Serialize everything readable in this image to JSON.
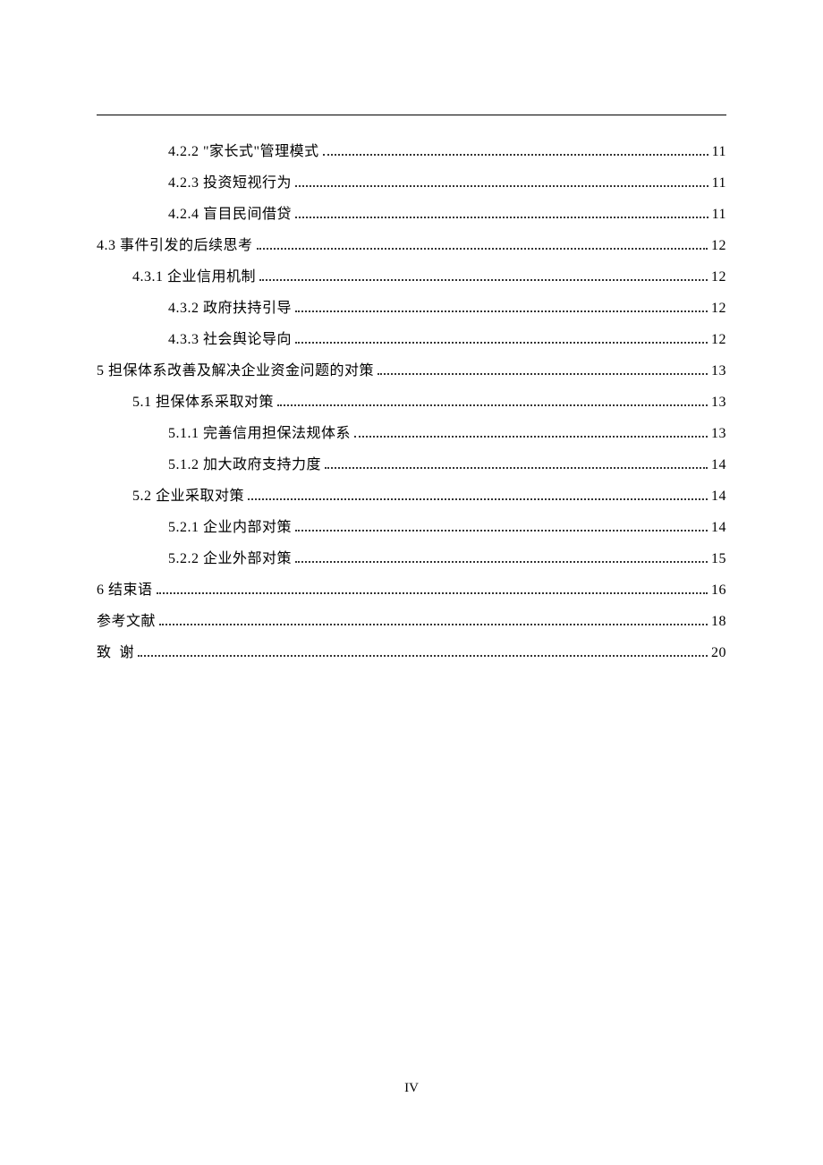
{
  "page_number_label": "IV",
  "toc": [
    {
      "indent": 2,
      "label": "4.2.2 \"家长式\"管理模式",
      "page": "11"
    },
    {
      "indent": 2,
      "label": "4.2.3 投资短视行为",
      "page": "11"
    },
    {
      "indent": 2,
      "label": "4.2.4 盲目民间借贷",
      "page": "11"
    },
    {
      "indent": 0,
      "label": "4.3 事件引发的后续思考",
      "page": "12"
    },
    {
      "indent": 1,
      "label": "4.3.1 企业信用机制",
      "page": "12"
    },
    {
      "indent": 2,
      "label": "4.3.2 政府扶持引导",
      "page": "12"
    },
    {
      "indent": 2,
      "label": "4.3.3 社会舆论导向",
      "page": "12"
    },
    {
      "indent": 0,
      "label": "5 担保体系改善及解决企业资金问题的对策",
      "page": "13"
    },
    {
      "indent": 1,
      "label": "5.1 担保体系采取对策",
      "page": "13"
    },
    {
      "indent": 2,
      "label": "5.1.1 完善信用担保法规体系",
      "page": "13"
    },
    {
      "indent": 2,
      "label": "5.1.2 加大政府支持力度",
      "page": "14"
    },
    {
      "indent": 1,
      "label": "5.2 企业采取对策",
      "page": "14"
    },
    {
      "indent": 2,
      "label": "5.2.1 企业内部对策",
      "page": "14"
    },
    {
      "indent": 2,
      "label": "5.2.2 企业外部对策",
      "page": "15"
    },
    {
      "indent": 0,
      "label": "6 结束语",
      "page": "16"
    },
    {
      "indent": 0,
      "label": "参考文献",
      "page": "18"
    },
    {
      "indent": 0,
      "label": "致  谢",
      "page": "20"
    }
  ]
}
